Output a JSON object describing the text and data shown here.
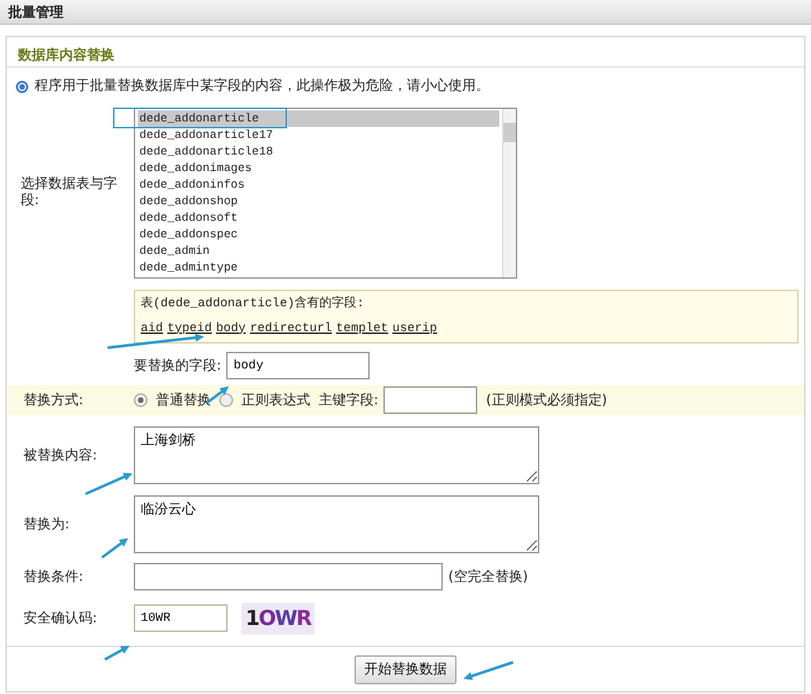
{
  "header": {
    "title": "批量管理"
  },
  "panel": {
    "subtitle": "数据库内容替换",
    "notice": "程序用于批量替换数据库中某字段的内容，此操作极为危险，请小心使用。"
  },
  "table_select": {
    "label": "选择数据表与字段:",
    "options": [
      {
        "text": "dede_addonarticle",
        "selected": true
      },
      {
        "text": "dede_addonarticle17",
        "selected": false
      },
      {
        "text": "dede_addonarticle18",
        "selected": false
      },
      {
        "text": "dede_addonimages",
        "selected": false
      },
      {
        "text": "dede_addoninfos",
        "selected": false
      },
      {
        "text": "dede_addonshop",
        "selected": false
      },
      {
        "text": "dede_addonsoft",
        "selected": false
      },
      {
        "text": "dede_addonspec",
        "selected": false
      },
      {
        "text": "dede_admin",
        "selected": false
      },
      {
        "text": "dede_admintype",
        "selected": false
      }
    ],
    "fields_caption": "表(dede_addonarticle)含有的字段:",
    "fields": [
      "aid",
      "typeid",
      "body",
      "redirecturl",
      "templet",
      "userip"
    ]
  },
  "field_to_replace": {
    "label": "要替换的字段:",
    "value": "body"
  },
  "mode": {
    "label": "替换方式:",
    "options": [
      {
        "text": "普通替换",
        "selected": true
      },
      {
        "text": "正则表达式",
        "selected": false
      }
    ],
    "key_label": "主键字段:",
    "hint": "(正则模式必须指定)"
  },
  "replace_from": {
    "label": "被替换内容:",
    "value": "上海剑桥"
  },
  "replace_to": {
    "label": "替换为:",
    "value": "临汾云心"
  },
  "condition": {
    "label": "替换条件:",
    "hint": "(空完全替换)"
  },
  "captcha": {
    "label": "安全确认码:",
    "value": "10WR",
    "image_text": "1OWR"
  },
  "submit": "开始替换数据"
}
